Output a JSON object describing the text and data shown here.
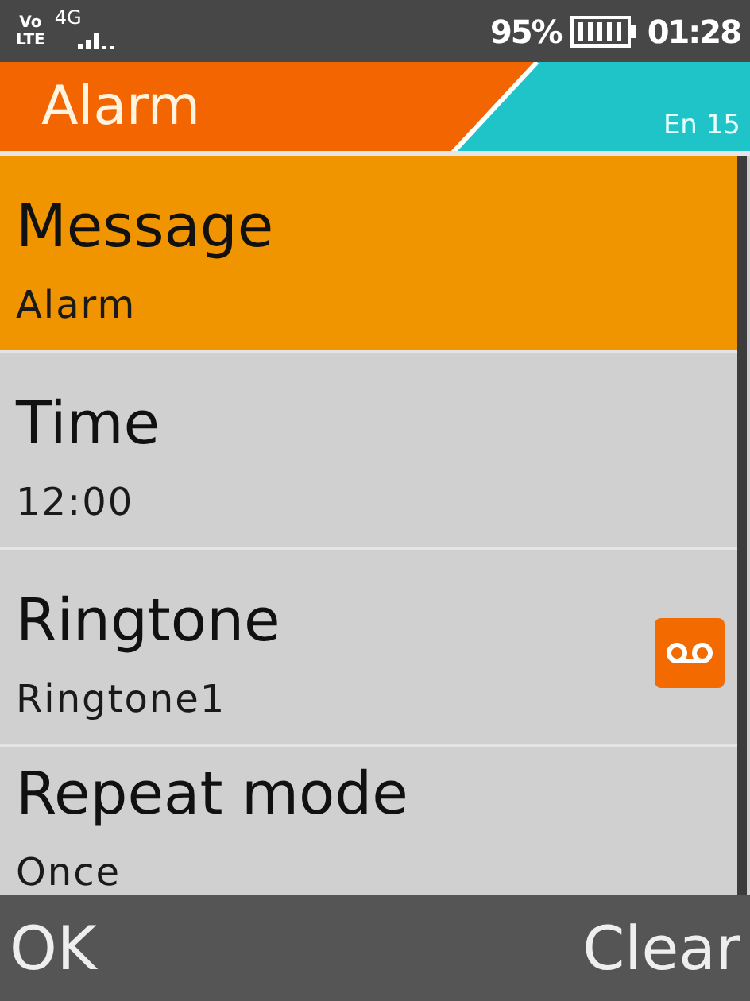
{
  "status_bar": {
    "volte_top": "Vo",
    "volte_bottom": "LTE",
    "network": "4G",
    "battery_percent": "95%",
    "time": "01:28"
  },
  "header": {
    "title": "Alarm",
    "input_mode": "En 15"
  },
  "fields": [
    {
      "label": "Message",
      "value": "Alarm",
      "selected": true,
      "kind": "text"
    },
    {
      "label": "Time",
      "value": "12:00",
      "selected": false,
      "kind": "text"
    },
    {
      "label": "Ringtone",
      "value": "Ringtone1",
      "selected": false,
      "kind": "ringtone"
    },
    {
      "label": "Repeat mode",
      "value": "Once",
      "selected": false,
      "kind": "text"
    }
  ],
  "softkeys": {
    "left": "OK",
    "right": "Clear"
  }
}
